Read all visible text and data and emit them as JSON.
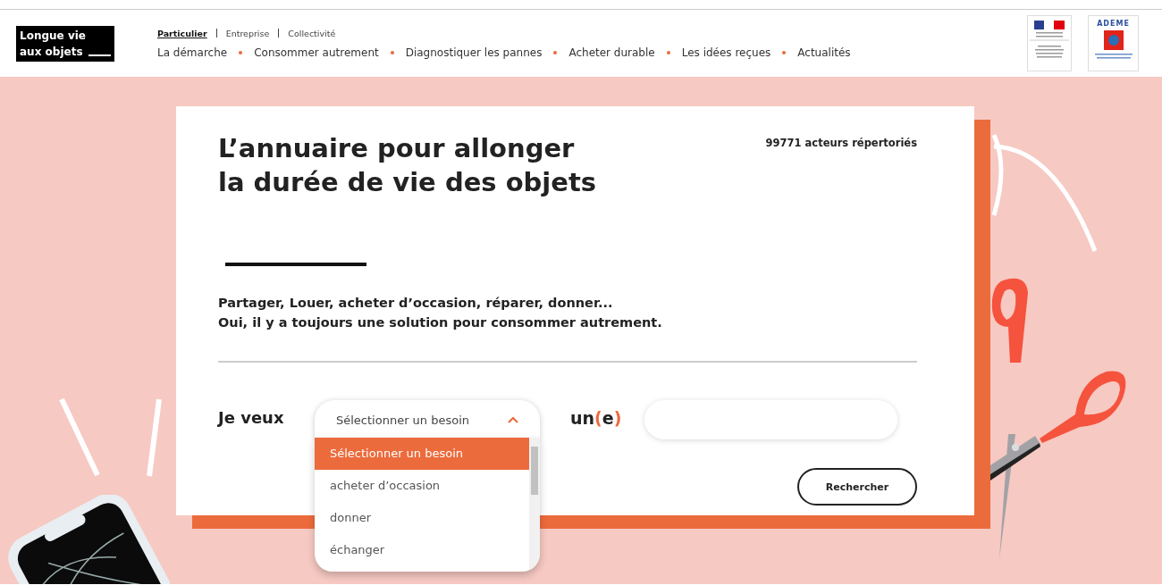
{
  "header": {
    "logo_lines": [
      "Longue vie",
      "aux objets"
    ],
    "audience_tabs": [
      {
        "label": "Particulier",
        "selected": true
      },
      {
        "label": "Entreprise",
        "selected": false
      },
      {
        "label": "Collectivité",
        "selected": false
      }
    ],
    "nav": [
      "La démarche",
      "Consommer autrement",
      "Diagnostiquer les pannes",
      "Acheter durable",
      "Les idées reçues",
      "Actualités"
    ],
    "partner_logo_text": "ADEME"
  },
  "card": {
    "title_lines": [
      "L’annuaire pour allonger",
      "la durée de vie des objets"
    ],
    "count": "99771 acteurs répertoriés",
    "intro_lines": [
      "Partager, Louer, acheter d’occasion, réparer, donner...",
      "Oui, il y a toujours une solution pour consommer autrement."
    ],
    "form": {
      "label": "Je veux",
      "select": {
        "value": "Sélectionner un besoin",
        "expanded": true,
        "options": [
          {
            "label": "Sélectionner un besoin",
            "selected": true
          },
          {
            "label": "acheter d’occasion",
            "selected": false
          },
          {
            "label": "donner",
            "selected": false
          },
          {
            "label": "échanger",
            "selected": false
          }
        ]
      },
      "connector": [
        {
          "text": "un",
          "accent": false
        },
        {
          "text": "(",
          "accent": true
        },
        {
          "text": "e",
          "accent": false
        },
        {
          "text": ")",
          "accent": true
        }
      ],
      "search_button": "Rechercher"
    }
  }
}
